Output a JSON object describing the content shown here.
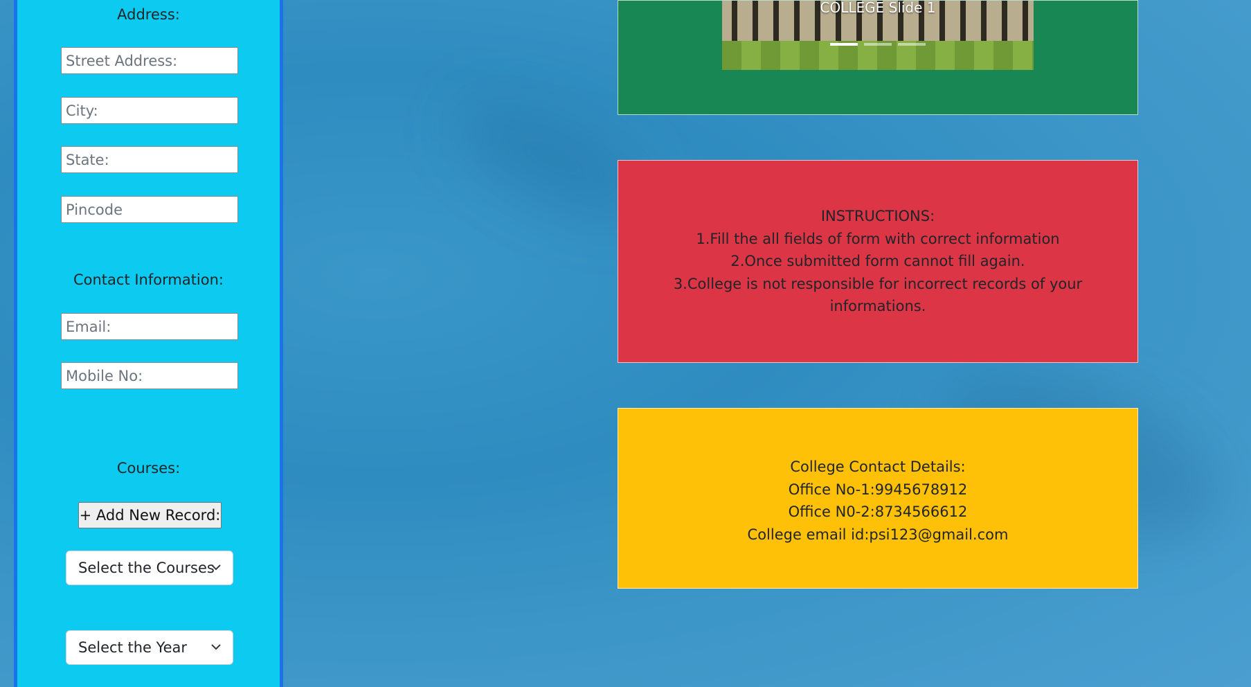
{
  "form": {
    "address_label": "Address:",
    "street_placeholder": "Street Address:",
    "city_placeholder": "City:",
    "state_placeholder": "State:",
    "pincode_placeholder": "Pincode",
    "contact_label": "Contact Information:",
    "email_placeholder": "Email:",
    "mobile_placeholder": "Mobile No:",
    "courses_label": "Courses:",
    "add_record_label": "+ Add New Record:",
    "course_select": "Select the Courses",
    "year_select": "Select the Year"
  },
  "carousel": {
    "caption": "COLLEGE Slide 1",
    "indicators": 3,
    "active_index": 0
  },
  "instructions": {
    "title": "INSTRUCTIONS:",
    "line1": "1.Fill the all fields of form with correct information",
    "line2": "2.Once submitted form cannot fill again.",
    "line3a": "3.College is not responsible for incorrect records of your",
    "line3b": "informations."
  },
  "contact": {
    "title": "College Contact Details:",
    "office1": "Office No-1:9945678912",
    "office2": "Office N0-2:8734566612",
    "email": "College email id:psi123@gmail.com"
  },
  "colors": {
    "sidebar": "#0dcaf0",
    "carousel_panel": "#198754",
    "instructions_panel": "#dc3545",
    "contact_panel": "#ffc107"
  }
}
